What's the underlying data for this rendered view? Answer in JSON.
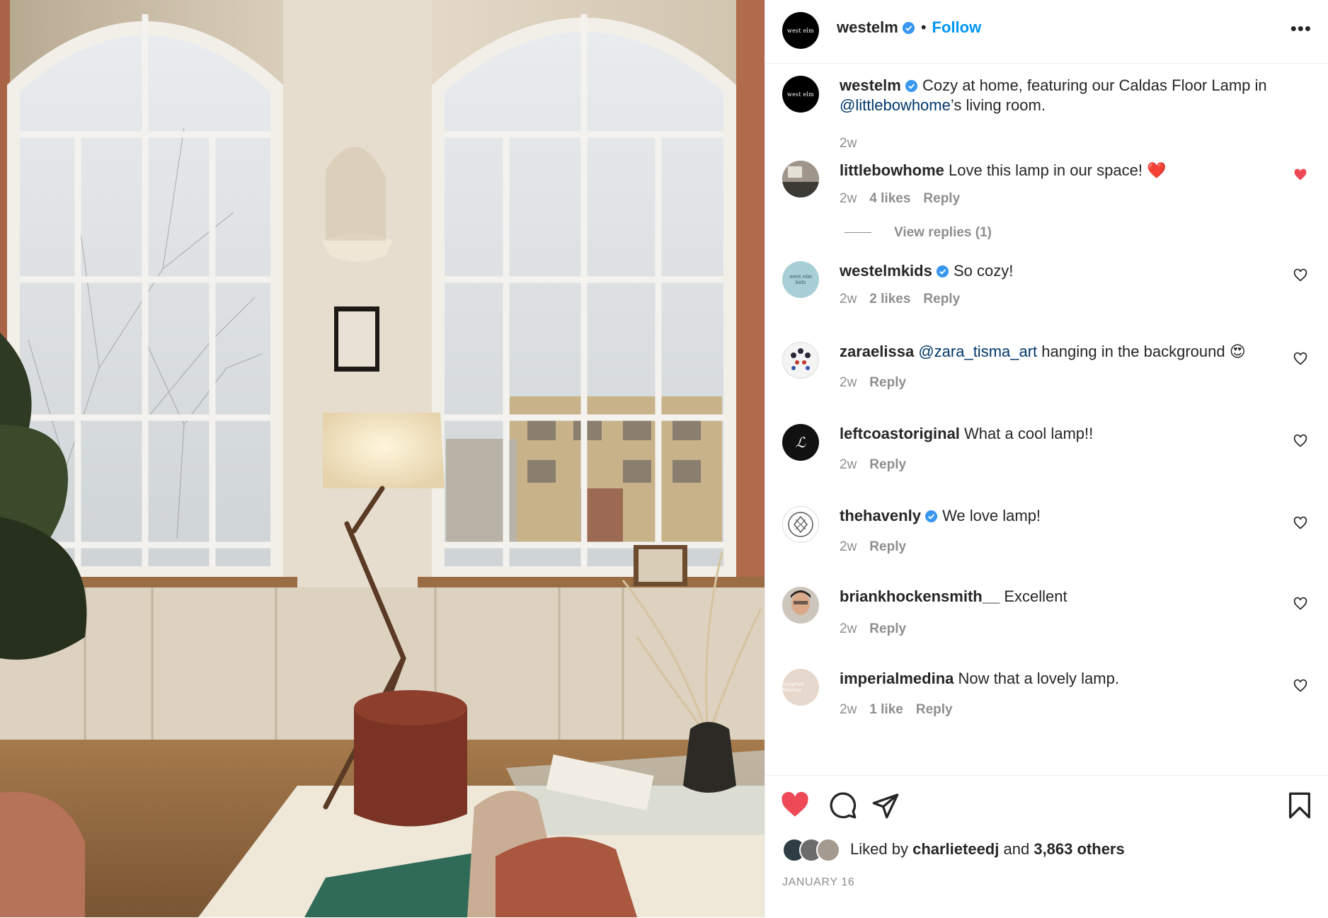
{
  "header": {
    "username": "westelm",
    "avatar_text": "west elm",
    "separator": "•",
    "follow_label": "Follow",
    "more_icon": "more-horizontal-icon"
  },
  "caption": {
    "username": "westelm",
    "text_before": "Cozy at home, featuring our Caldas Floor Lamp in",
    "mention": "@littlebowhome",
    "text_after": "’s living room.",
    "time": "2w"
  },
  "comments": [
    {
      "username": "littlebowhome",
      "mention": "",
      "text": "Love this lamp in our space!",
      "emoji": "❤️",
      "time": "2w",
      "likes": "4 likes",
      "reply": "Reply",
      "liked": true,
      "view_replies": "View replies (1)"
    },
    {
      "username": "westelmkids",
      "mention": "",
      "text": "So cozy!",
      "emoji": "",
      "time": "2w",
      "likes": "2 likes",
      "reply": "Reply",
      "liked": false,
      "verified": true
    },
    {
      "username": "zaraelissa",
      "mention": "@zara_tisma_art",
      "text": "hanging in the background",
      "emoji": "😍",
      "time": "2w",
      "likes": "",
      "reply": "Reply",
      "liked": false
    },
    {
      "username": "leftcoastoriginal",
      "mention": "",
      "text": "What a cool lamp!!",
      "emoji": "",
      "time": "2w",
      "likes": "",
      "reply": "Reply",
      "liked": false
    },
    {
      "username": "thehavenly",
      "mention": "",
      "text": "We love lamp!",
      "emoji": "",
      "time": "2w",
      "likes": "",
      "reply": "Reply",
      "liked": false,
      "verified": true
    },
    {
      "username": "briankhockensmith__",
      "mention": "",
      "text": "Excellent",
      "emoji": "",
      "time": "2w",
      "likes": "",
      "reply": "Reply",
      "liked": false
    },
    {
      "username": "imperialmedina",
      "mention": "",
      "text": "Now that a lovely lamp.",
      "emoji": "",
      "time": "2w",
      "likes": "1 like",
      "reply": "Reply",
      "liked": false
    }
  ],
  "actions": {
    "liked_by_prefix": "Liked by",
    "liked_by_user": "charlieteedj",
    "liked_by_and": "and",
    "liked_by_others": "3,863 others",
    "date": "JANUARY 16"
  },
  "colors": {
    "accent": "#0095f6",
    "like": "#ed4956",
    "text": "#262626",
    "muted": "#8e8e8e",
    "verified": "#3897f0"
  }
}
